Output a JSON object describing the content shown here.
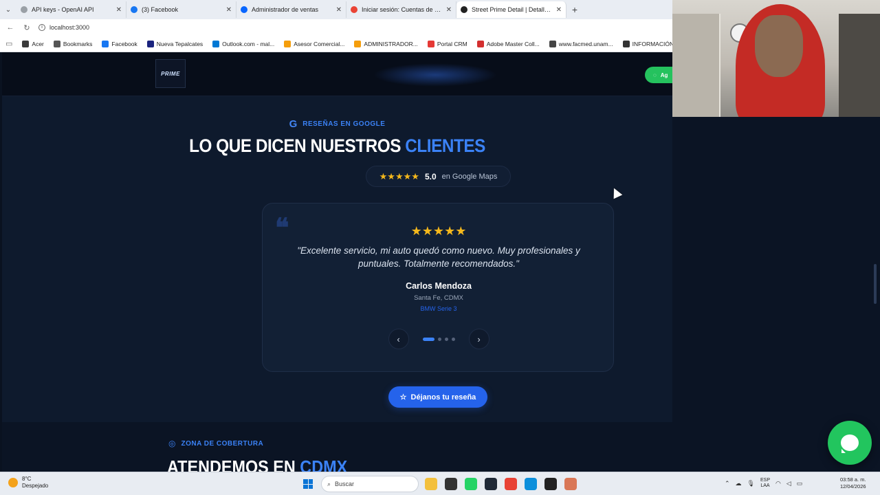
{
  "browser": {
    "tabs": [
      {
        "title": "API keys - OpenAI API",
        "fav_color": "#9aa0a6",
        "active": false
      },
      {
        "title": "(3) Facebook",
        "fav_color": "#1877f2",
        "active": false
      },
      {
        "title": "Administrador de ventas",
        "fav_color": "#0866ff",
        "active": false
      },
      {
        "title": "Iniciar sesión: Cuentas de Google",
        "fav_color": "#ea4335",
        "active": false
      },
      {
        "title": "Street Prime Detail | Detallado Aut",
        "fav_color": "#222222",
        "active": true
      }
    ],
    "tab_close": "✕",
    "new_tab": "+",
    "url": "localhost:3000",
    "bookmarks": [
      {
        "label": "Acer",
        "color": "#3a3a3a"
      },
      {
        "label": "Bookmarks",
        "color": "#555555"
      },
      {
        "label": "Facebook",
        "color": "#1877f2"
      },
      {
        "label": "Nueva Tepalcates",
        "color": "#1a237e"
      },
      {
        "label": "Outlook.com - mal...",
        "color": "#0078d4"
      },
      {
        "label": "Asesor Comercial...",
        "color": "#f59e0b"
      },
      {
        "label": "ADMINISTRADOR...",
        "color": "#f59e0b"
      },
      {
        "label": "Portal CRM",
        "color": "#e53935"
      },
      {
        "label": "Adobe Master Coll...",
        "color": "#d32f2f"
      },
      {
        "label": "www.facmed.unam...",
        "color": "#444444"
      },
      {
        "label": "INFORMACIÓN DE...",
        "color": "#333333"
      }
    ]
  },
  "site": {
    "logo_text": "PRIME",
    "header_whatsapp_label": "Ag"
  },
  "reviews": {
    "eyebrow_icon": "G",
    "eyebrow": "RESEÑAS EN GOOGLE",
    "headline_main": "LO QUE DICEN NUESTROS",
    "headline_accent": "CLIENTES",
    "rating_stars": "★★★★★",
    "rating_score": "5.0",
    "rating_source": "en Google Maps",
    "card": {
      "quote_icon": "❝",
      "stars": "★★★★★",
      "text": "\"Excelente servicio, mi auto quedó como nuevo. Muy profesionales y puntuales. Totalmente recomendados.\"",
      "name": "Carlos Mendoza",
      "location": "Santa Fe, CDMX",
      "car": "BMW Serie 3"
    },
    "prev_icon": "‹",
    "next_icon": "›",
    "active_dot": 0,
    "dot_count": 4,
    "cta_icon": "☆",
    "cta_label": "Déjanos tu reseña"
  },
  "coverage": {
    "eyebrow_icon": "◎",
    "eyebrow": "ZONA DE COBERTURA",
    "headline_main": "ATENDEMOS EN",
    "headline_accent": "CDMX"
  },
  "taskbar": {
    "weather_temp": "8°C",
    "weather_desc": "Despejado",
    "search_placeholder": "Buscar",
    "lang_top": "ESP",
    "lang_bottom": "LAA",
    "time": "03:58 a. m.",
    "date": "12/04/2026"
  }
}
